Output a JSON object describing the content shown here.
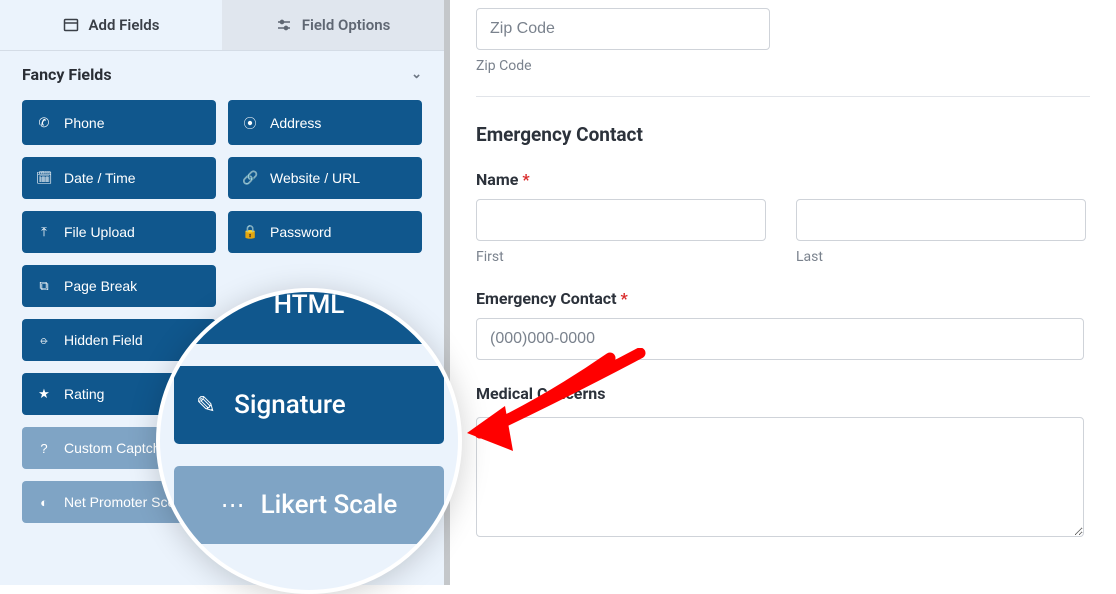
{
  "tabs": {
    "add": "Add Fields",
    "options": "Field Options"
  },
  "section": {
    "title": "Fancy Fields"
  },
  "fields": {
    "phone": "Phone",
    "address": "Address",
    "datetime": "Date / Time",
    "url": "Website / URL",
    "upload": "File Upload",
    "password": "Password",
    "pagebreak": "Page Break",
    "hidden": "Hidden Field",
    "rating": "Rating",
    "captcha": "Custom Captcha",
    "nps": "Net Promoter Score"
  },
  "magnifier": {
    "html": "HTML",
    "signature": "Signature",
    "likert": "Likert Scale"
  },
  "form": {
    "zip_placeholder": "Zip Code",
    "zip_label": "Zip Code",
    "h_emergency": "Emergency Contact",
    "name_label": "Name",
    "first_label": "First",
    "last_label": "Last",
    "ec_label": "Emergency Contact",
    "ec_placeholder": "(000)000-0000",
    "medical_label": "Medical Concerns"
  }
}
